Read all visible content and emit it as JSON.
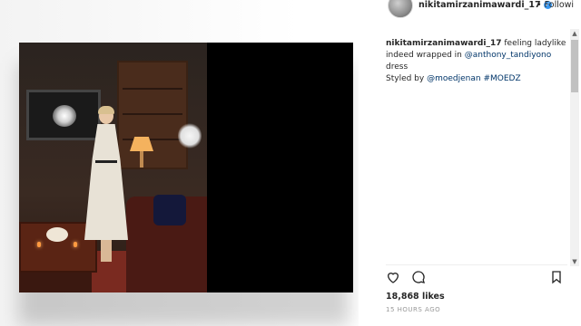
{
  "post": {
    "username": "nikitamirzanimawardi_17",
    "follow_label": "Followi",
    "caption_user": "nikitamirzanimawardi_17",
    "caption_line1": "feeling ladylike indeed wrapped in",
    "mention1": "@anthony_tandiyono",
    "caption_line2": "dress",
    "caption_line3": "Styled by",
    "mention2": "@moedjenan",
    "hashtag": "#MOEDZ",
    "likes": "18,868 likes",
    "time": "15 HOURS AGO"
  },
  "icons": {
    "like": "heart-icon",
    "comment": "comment-icon",
    "save": "bookmark-icon",
    "verified": "verified-badge-icon"
  },
  "colors": {
    "link": "#003569",
    "verified": "#3897f0",
    "text": "#262626",
    "muted": "#999999"
  }
}
